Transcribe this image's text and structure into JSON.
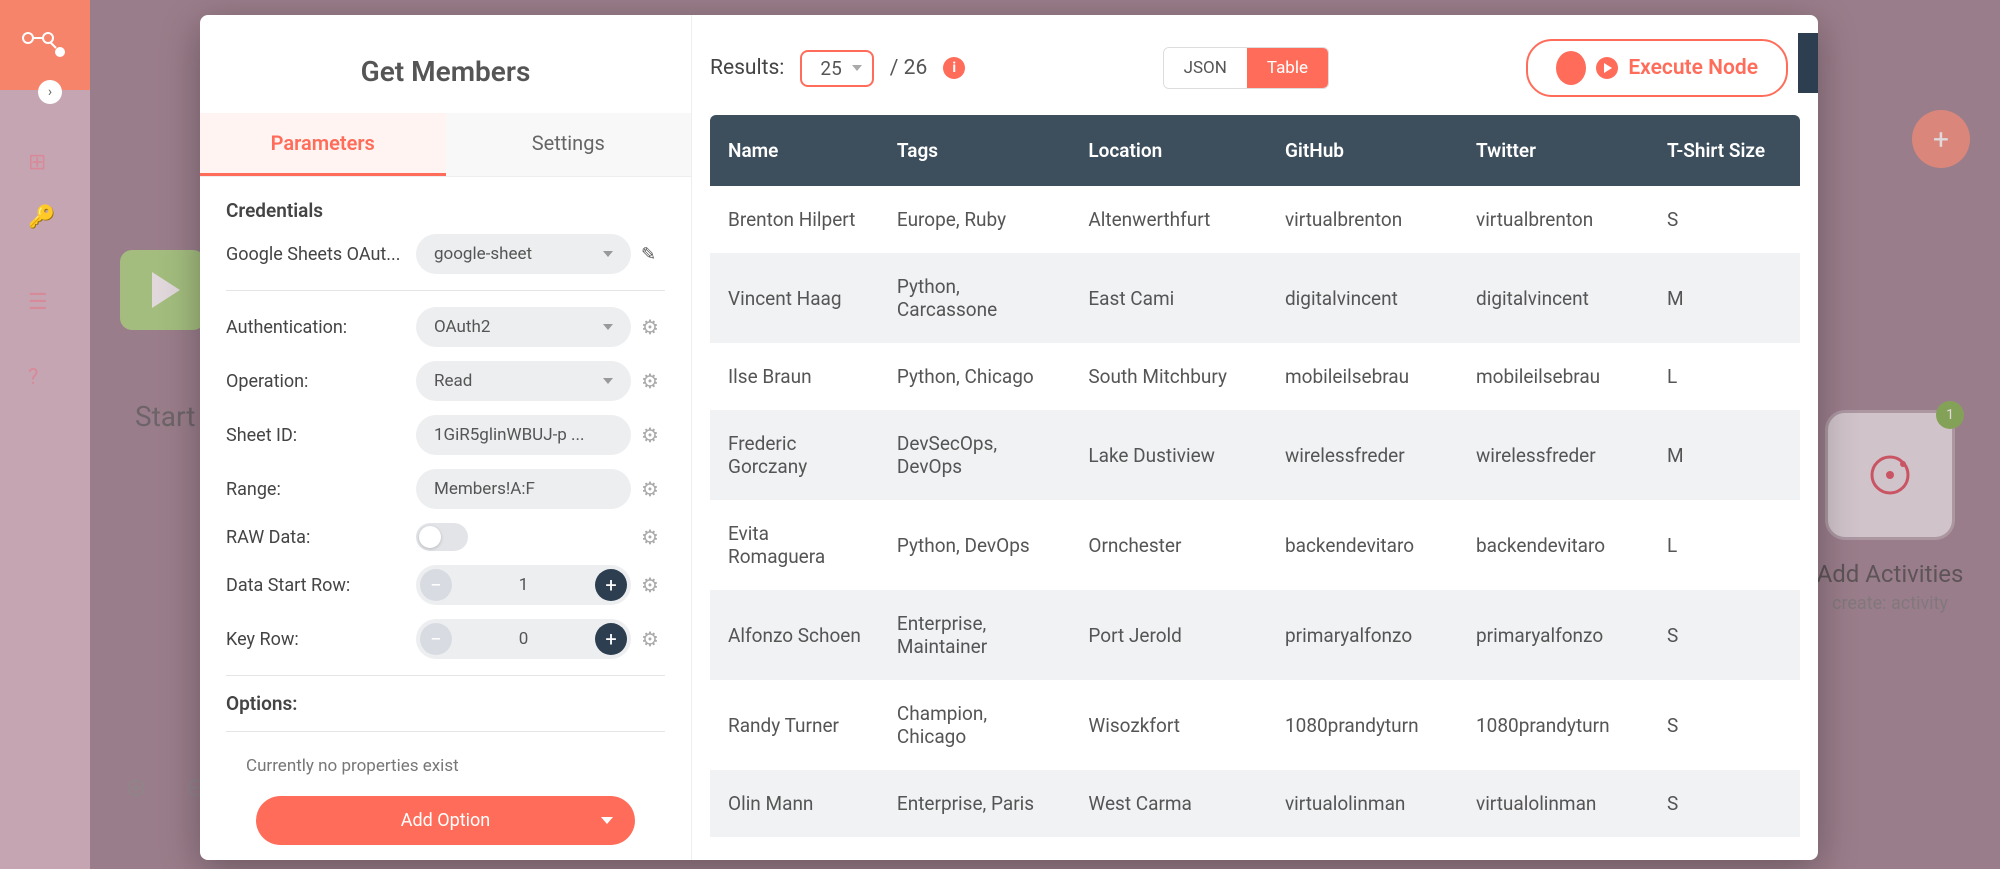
{
  "bg": {
    "start_label": "Start",
    "activities_title": "Add Activities",
    "activities_subtitle": "create: activity",
    "activities_badge": "1"
  },
  "modal": {
    "title": "Get Members",
    "tabs": {
      "parameters": "Parameters",
      "settings": "Settings"
    },
    "credentials_title": "Credentials",
    "credential_label": "Google Sheets OAut...",
    "credential_value": "google-sheet",
    "fields": {
      "authentication": {
        "label": "Authentication:",
        "value": "OAuth2"
      },
      "operation": {
        "label": "Operation:",
        "value": "Read"
      },
      "sheet_id": {
        "label": "Sheet ID:",
        "value": "1GiR5glinWBUJ-p ..."
      },
      "range": {
        "label": "Range:",
        "value": "Members!A:F"
      },
      "raw_data": {
        "label": "RAW Data:"
      },
      "data_start_row": {
        "label": "Data Start Row:",
        "value": "1"
      },
      "key_row": {
        "label": "Key Row:",
        "value": "0"
      }
    },
    "options_title": "Options:",
    "options_empty": "Currently no properties exist",
    "add_option": "Add Option"
  },
  "results": {
    "label": "Results:",
    "count": "25",
    "total": "/ 26",
    "view_json": "JSON",
    "view_table": "Table",
    "execute": "Execute Node"
  },
  "table": {
    "headers": [
      "Name",
      "Tags",
      "Location",
      "GitHub",
      "Twitter",
      "T-Shirt Size"
    ],
    "rows": [
      [
        "Brenton Hilpert",
        "Europe, Ruby",
        "Altenwerthfurt",
        "virtualbrenton",
        "virtualbrenton",
        "S"
      ],
      [
        "Vincent Haag",
        "Python, Carcassone",
        "East Cami",
        "digitalvincent",
        "digitalvincent",
        "M"
      ],
      [
        "Ilse Braun",
        "Python, Chicago",
        "South Mitchbury",
        "mobileilsebrau",
        "mobileilsebrau",
        "L"
      ],
      [
        "Frederic Gorczany",
        "DevSecOps, DevOps",
        "Lake Dustiview",
        "wirelessfreder",
        "wirelessfreder",
        "M"
      ],
      [
        "Evita Romaguera",
        "Python, DevOps",
        "Ornchester",
        "backendevitaro",
        "backendevitaro",
        "L"
      ],
      [
        "Alfonzo Schoen",
        "Enterprise, Maintainer",
        "Port Jerold",
        "primaryalfonzo",
        "primaryalfonzo",
        "S"
      ],
      [
        "Randy Turner",
        "Champion, Chicago",
        "Wisozkfort",
        "1080prandyturn",
        "1080prandyturn",
        "S"
      ],
      [
        "Olin Mann",
        "Enterprise, Paris",
        "West Carma",
        "virtualolinman",
        "virtualolinman",
        "S"
      ]
    ]
  }
}
